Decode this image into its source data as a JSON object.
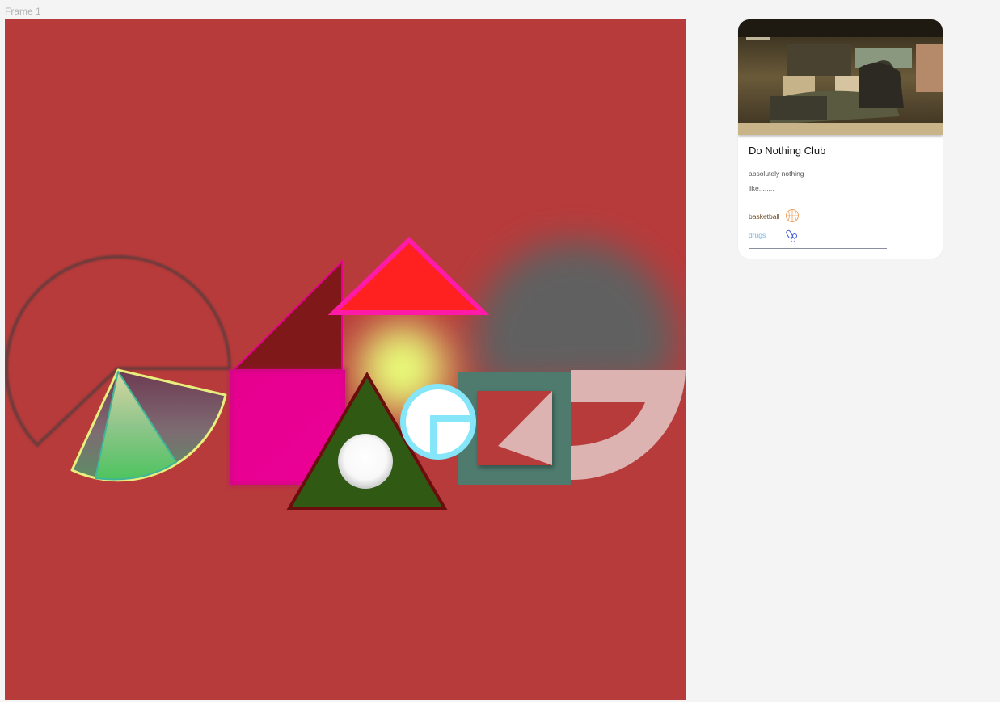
{
  "frame": {
    "label": "Frame 1",
    "background": "#b83b3b"
  },
  "card": {
    "image_alt": "Game screenshot of a man reclining with feet on a desk in an office",
    "title": "Do Nothing Club",
    "description_lines": [
      "absolutely nothing",
      "like........"
    ],
    "tags": [
      {
        "label": "basketball",
        "color": "#6b4a1e",
        "icon": "basketball-icon",
        "icon_color": "#f0a060"
      },
      {
        "label": "drugs",
        "color": "#6fb3e8",
        "icon": "pills-icon",
        "icon_color": "#3d57d6"
      }
    ]
  },
  "colors": {
    "canvas": "#b83b3b",
    "magenta": "#e6008f",
    "pink_stroke": "#ff1aa8",
    "red_triangle": "#ff2020",
    "dark_red": "#7f1818",
    "olive": "#305a14",
    "cyan": "#84e6f8",
    "teal": "#4e7b6e",
    "grey_blob": "#606060",
    "yellow_glow": "#e9ff7a",
    "pale_pink": "#dcb3b0",
    "green": "#4cc35f",
    "yellow_stroke": "#e8ef7c"
  }
}
